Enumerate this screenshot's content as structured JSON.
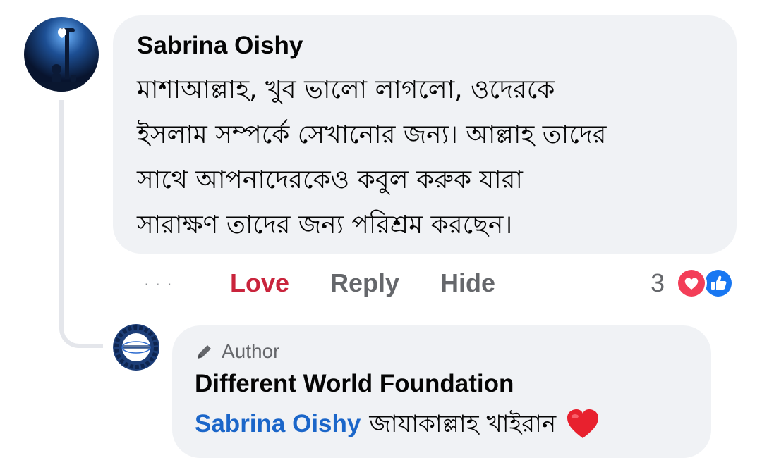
{
  "comment": {
    "author": "Sabrina Oishy",
    "text": "মাশাআল্লাহ, খুব ভালো লাগলো, ওদেরকে\nইসলাম সম্পর্কে সেখানোর জন্য।  আল্লাহ তাদের\nসাথে আপনাদেরকেও কবুল করুক যারা\nসারাক্ষণ তাদের জন্য পরিশ্রম করছেন।",
    "avatar_icon": "avatar-night-lamp-icon"
  },
  "actions": {
    "time": "· · ·",
    "love_label": "Love",
    "reply_label": "Reply",
    "hide_label": "Hide"
  },
  "reactions": {
    "count": "3",
    "icons": [
      "love-reaction-icon",
      "like-reaction-icon"
    ],
    "love_color": "#f33e58",
    "like_color": "#1877f2"
  },
  "reply": {
    "badge": "Author",
    "badge_icon": "pencil-icon",
    "author": "Different World Foundation",
    "mention": "Sabrina Oishy",
    "text": "জাযাকাল্লাহ খাইরান",
    "emoji": "heart-emoji",
    "avatar_icon": "globe-logo-icon"
  },
  "colors": {
    "bubble": "#f0f2f5",
    "love_text": "#c9243c",
    "mention": "#1b66c9",
    "muted": "#65676b"
  }
}
